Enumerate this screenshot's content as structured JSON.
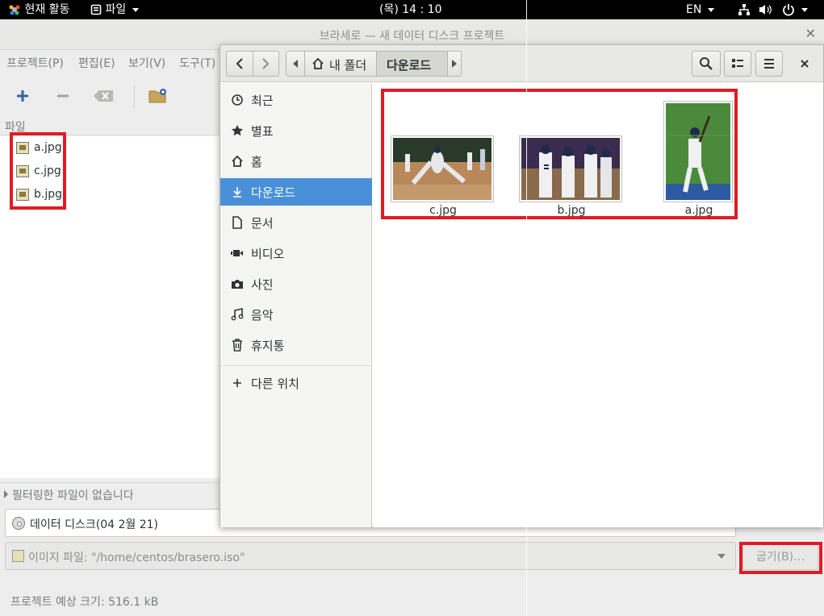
{
  "topbar": {
    "activities": "현재 활동",
    "app_menu": "파일",
    "clock": "(목) 14 : 10",
    "lang": "EN"
  },
  "brasero": {
    "title": "브라세로 — 새 데이터 디스크 프로젝트",
    "menu": [
      "프로젝트(P)",
      "편집(E)",
      "보기(V)",
      "도구(T)"
    ],
    "files_header": "파일",
    "files": [
      "a.jpg",
      "c.jpg",
      "b.jpg"
    ],
    "filter_text": "필터링한 파일이 없습니다",
    "disc_label": "데이터 디스크(04  2월 21)",
    "image_file": "이미지 파일: \"/home/centos/brasero.iso\"",
    "burn_label": "굽기(B)…",
    "estimated_size": "프로젝트 예상 크기: 516.1 kB"
  },
  "dialog": {
    "path": [
      "내 폴더",
      "다운로드"
    ],
    "places": [
      {
        "label": "최근",
        "icon": "clock-icon"
      },
      {
        "label": "별표",
        "icon": "star-icon"
      },
      {
        "label": "홈",
        "icon": "home-icon"
      },
      {
        "label": "다운로드",
        "icon": "download-icon",
        "active": true
      },
      {
        "label": "문서",
        "icon": "document-icon"
      },
      {
        "label": "비디오",
        "icon": "video-icon"
      },
      {
        "label": "사진",
        "icon": "camera-icon"
      },
      {
        "label": "음악",
        "icon": "music-icon"
      },
      {
        "label": "휴지통",
        "icon": "trash-icon"
      }
    ],
    "other_locations": "다른 위치",
    "files": [
      "c.jpg",
      "b.jpg",
      "a.jpg"
    ]
  },
  "colors": {
    "accent": "#4a90d9",
    "highlight": "#e01b24"
  }
}
